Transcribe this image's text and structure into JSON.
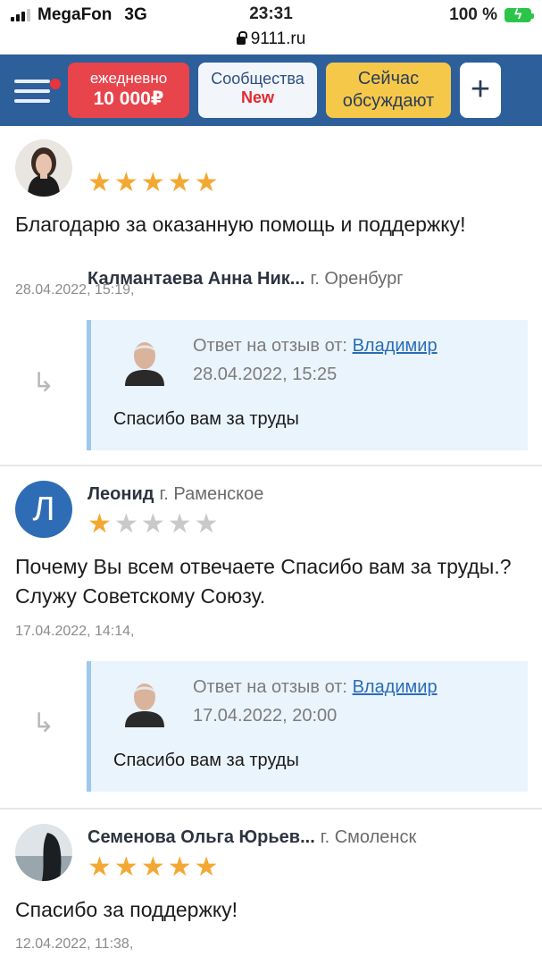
{
  "status": {
    "carrier": "MegaFon",
    "network": "3G",
    "time": "23:31",
    "battery": "100 %"
  },
  "url": "9111.ru",
  "nav": {
    "daily_line1": "ежедневно",
    "daily_line2": "10 000₽",
    "communities_line1": "Сообщества",
    "communities_line2": "New",
    "discussing_line1": "Сейчас",
    "discussing_line2": "обсуждают",
    "plus": "+"
  },
  "reviews": [
    {
      "name": "Калмантаева Анна Ник...",
      "city": "г. Оренбург",
      "rating": 5,
      "text": "Благодарю за оказанную помощь и поддержку!",
      "date": "28.04.2022, 15:19,",
      "reply": {
        "label": "Ответ на отзыв от:",
        "author": "Владимир",
        "date": "28.04.2022, 15:25",
        "text": "Спасибо вам за труды"
      }
    },
    {
      "name": "Леонид",
      "city": "г. Раменское",
      "avatar_letter": "Л",
      "rating": 1,
      "text": "Почему Вы всем отвечаете Спасибо вам за труды.? Служу Советскому Союзу.",
      "date": "17.04.2022, 14:14,",
      "reply": {
        "label": "Ответ на отзыв от:",
        "author": "Владимир",
        "date": "17.04.2022, 20:00",
        "text": "Спасибо вам за труды"
      }
    },
    {
      "name": "Семенова Ольга Юрьев...",
      "city": "г. Смоленск",
      "rating": 5,
      "text": "Спасибо за поддержку!",
      "date": "12.04.2022, 11:38,"
    }
  ],
  "icons": {
    "reply_arrow": "↳",
    "star": "★"
  },
  "colors": {
    "header_bg": "#2d5f9a",
    "daily_bg": "#e8444c",
    "discussing_bg": "#f6c84a",
    "star": "#f3a833",
    "link": "#2b6cb6"
  }
}
